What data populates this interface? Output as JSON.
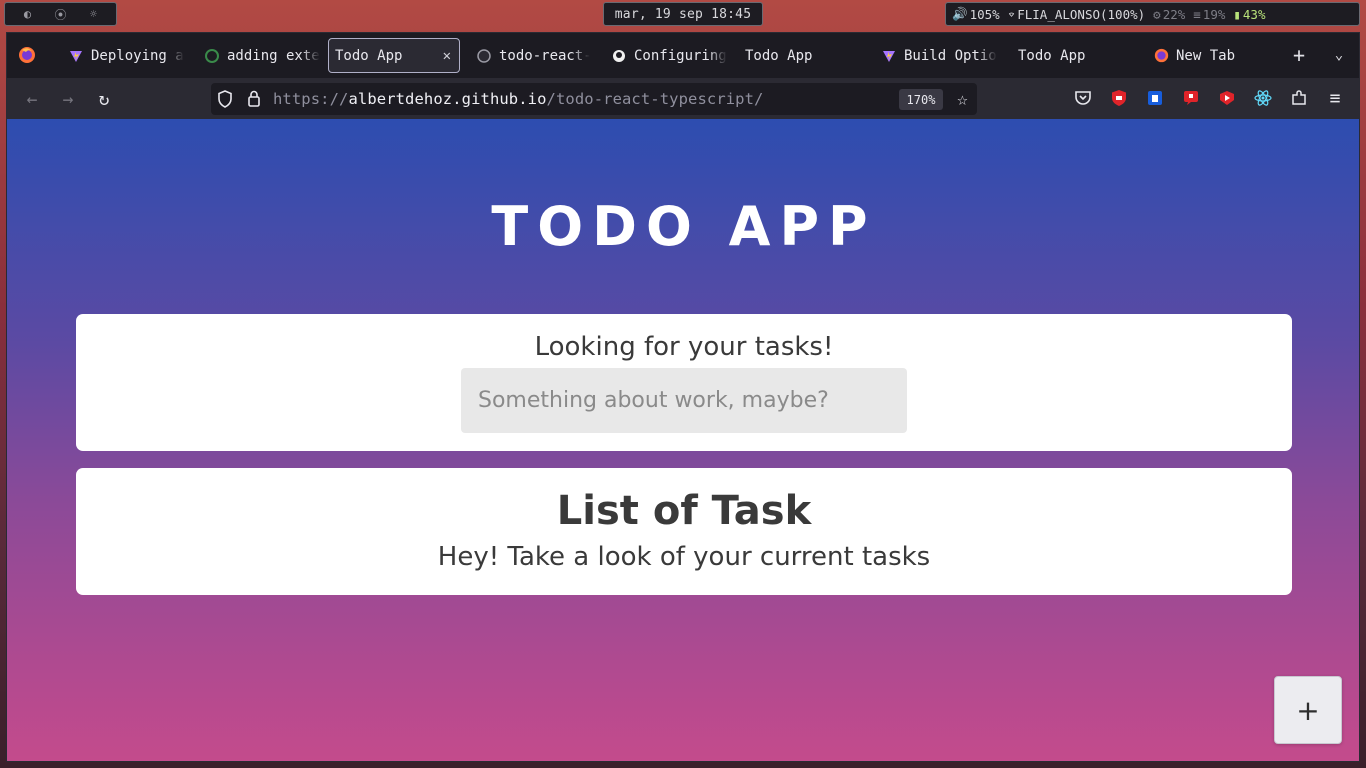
{
  "system": {
    "clock": "mar, 19 sep 18:45",
    "volume": "105%",
    "wifi": "FLIA_ALONSO(100%)",
    "cpu": "22%",
    "memory": "19%",
    "battery": "43%"
  },
  "browser": {
    "tabs": [
      {
        "label": "Deploying a",
        "icon": "vite-icon"
      },
      {
        "label": "adding exte",
        "icon": "github-icon"
      },
      {
        "label": "Todo App",
        "icon": "none",
        "active": true
      },
      {
        "label": "todo-react-",
        "icon": "github-icon"
      },
      {
        "label": "Configuring",
        "icon": "github-icon"
      },
      {
        "label": "Todo App",
        "icon": "none"
      },
      {
        "label": "Build Optio",
        "icon": "vite-icon"
      },
      {
        "label": "Todo App",
        "icon": "none"
      },
      {
        "label": "New Tab",
        "icon": "firefox-icon"
      }
    ],
    "url": {
      "scheme": "https://",
      "host": "albertdehoz.github.io",
      "path": "/todo-react-typescript/"
    },
    "zoom": "170%"
  },
  "page": {
    "title": "TODO APP",
    "search": {
      "heading": "Looking for your tasks!",
      "placeholder": "Something about work, maybe?"
    },
    "list": {
      "title": "List of Task",
      "subtitle": "Hey! Take a look of your current tasks"
    },
    "add_button": "+"
  }
}
